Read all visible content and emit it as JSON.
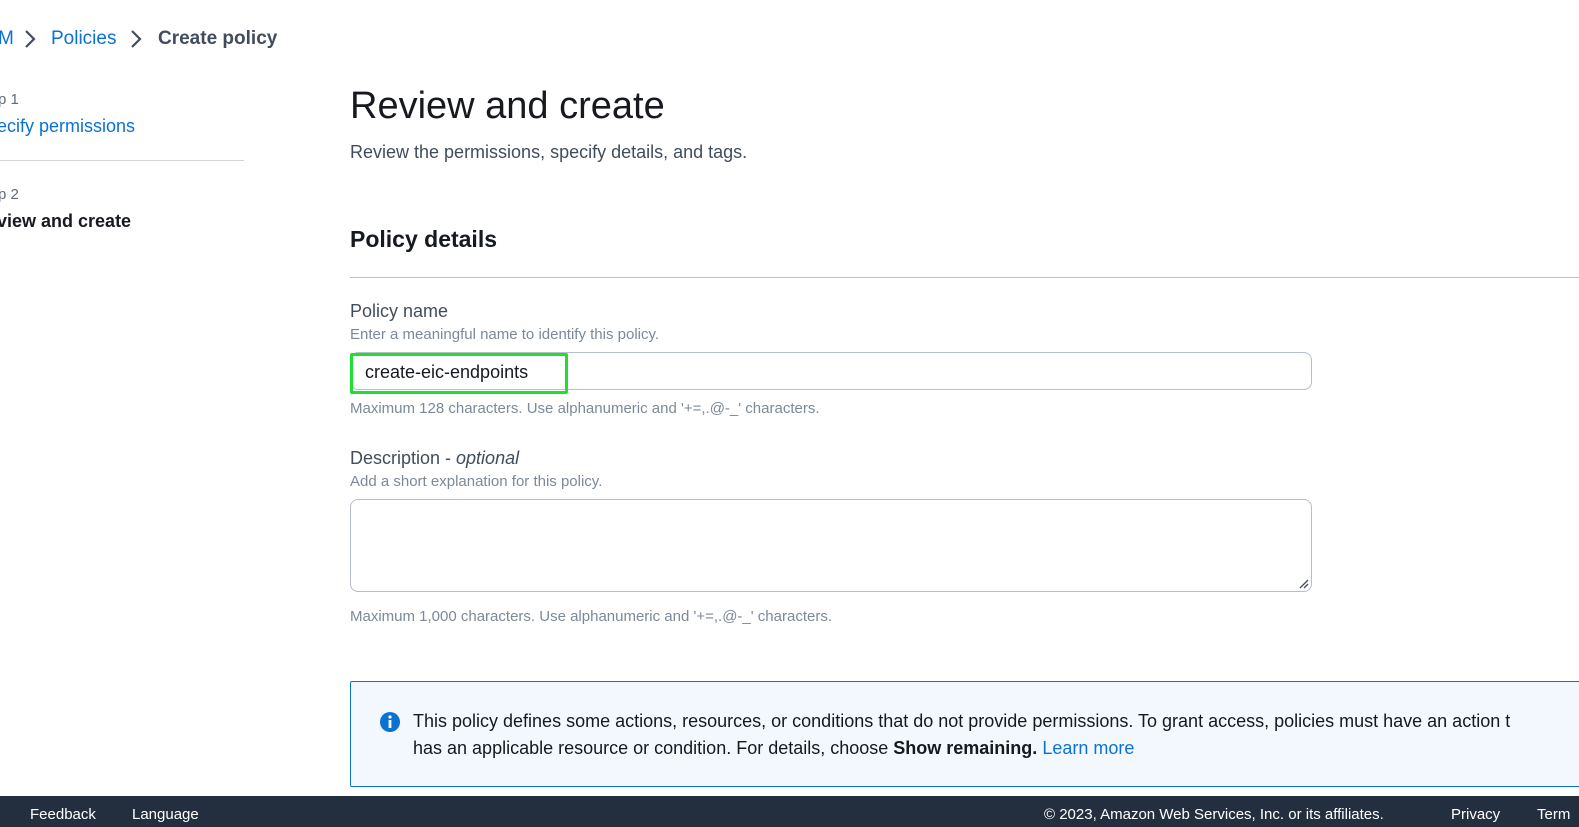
{
  "breadcrumb": {
    "root": "M",
    "policies": "Policies",
    "current": "Create policy"
  },
  "steps": [
    {
      "label": "p 1",
      "title": "ecify permissions"
    },
    {
      "label": "p 2",
      "title": "view and create"
    }
  ],
  "main": {
    "title": "Review and create",
    "subtitle": "Review the permissions, specify details, and tags.",
    "section_title": "Policy details",
    "policy_name": {
      "label": "Policy name",
      "hint": "Enter a meaningful name to identify this policy.",
      "value": "create-eic-endpoints",
      "constraint": "Maximum 128 characters. Use alphanumeric and '+=,.@-_' characters."
    },
    "description": {
      "label": "Description - ",
      "label_optional": "optional",
      "hint": "Add a short explanation for this policy.",
      "value": "",
      "constraint": "Maximum 1,000 characters. Use alphanumeric and '+=,.@-_' characters."
    },
    "info_alert": {
      "line1": "This policy defines some actions, resources, or conditions that do not provide permissions. To grant access, policies must have an action t",
      "line2_prefix": "has an applicable resource or condition. For details, choose ",
      "line2_bold": "Show remaining.",
      "link": "Learn more"
    }
  },
  "footer": {
    "feedback": "Feedback",
    "language": "Language",
    "copyright": "© 2023, Amazon Web Services, Inc. or its affiliates.",
    "privacy": "Privacy",
    "terms": "Term"
  },
  "colors": {
    "link": "#0972d3",
    "highlight": "#1fe032",
    "footer_bg": "#232f3e",
    "info_bg": "#f2f8fd"
  },
  "icons": [
    "chevron-right-icon",
    "info-icon",
    "resize-grip-icon"
  ]
}
